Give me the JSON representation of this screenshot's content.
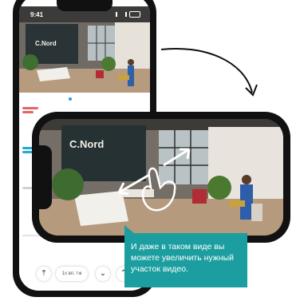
{
  "portrait_app": {
    "status_time": "9:41",
    "logo": "C.Nord",
    "speed_label": "1x вп. тж",
    "events": [
      {
        "color": "#e46464"
      },
      {
        "color": "#2aa8d0"
      },
      {
        "color": "#d0d0d0"
      }
    ]
  },
  "landscape_app": {
    "logo": "C.Nord"
  },
  "callout": {
    "text": "И даже в таком виде вы можете увеличить нужный участок видео."
  },
  "colors": {
    "accent": "#1c9ea0",
    "phone_frame": "#111111",
    "event_red": "#e46464",
    "event_blue": "#2aa8d0"
  },
  "icons": [
    "pinch-zoom-hand-icon",
    "curved-arrow-icon",
    "chevron-down-icon",
    "chevron-up-icon",
    "upload-icon"
  ]
}
